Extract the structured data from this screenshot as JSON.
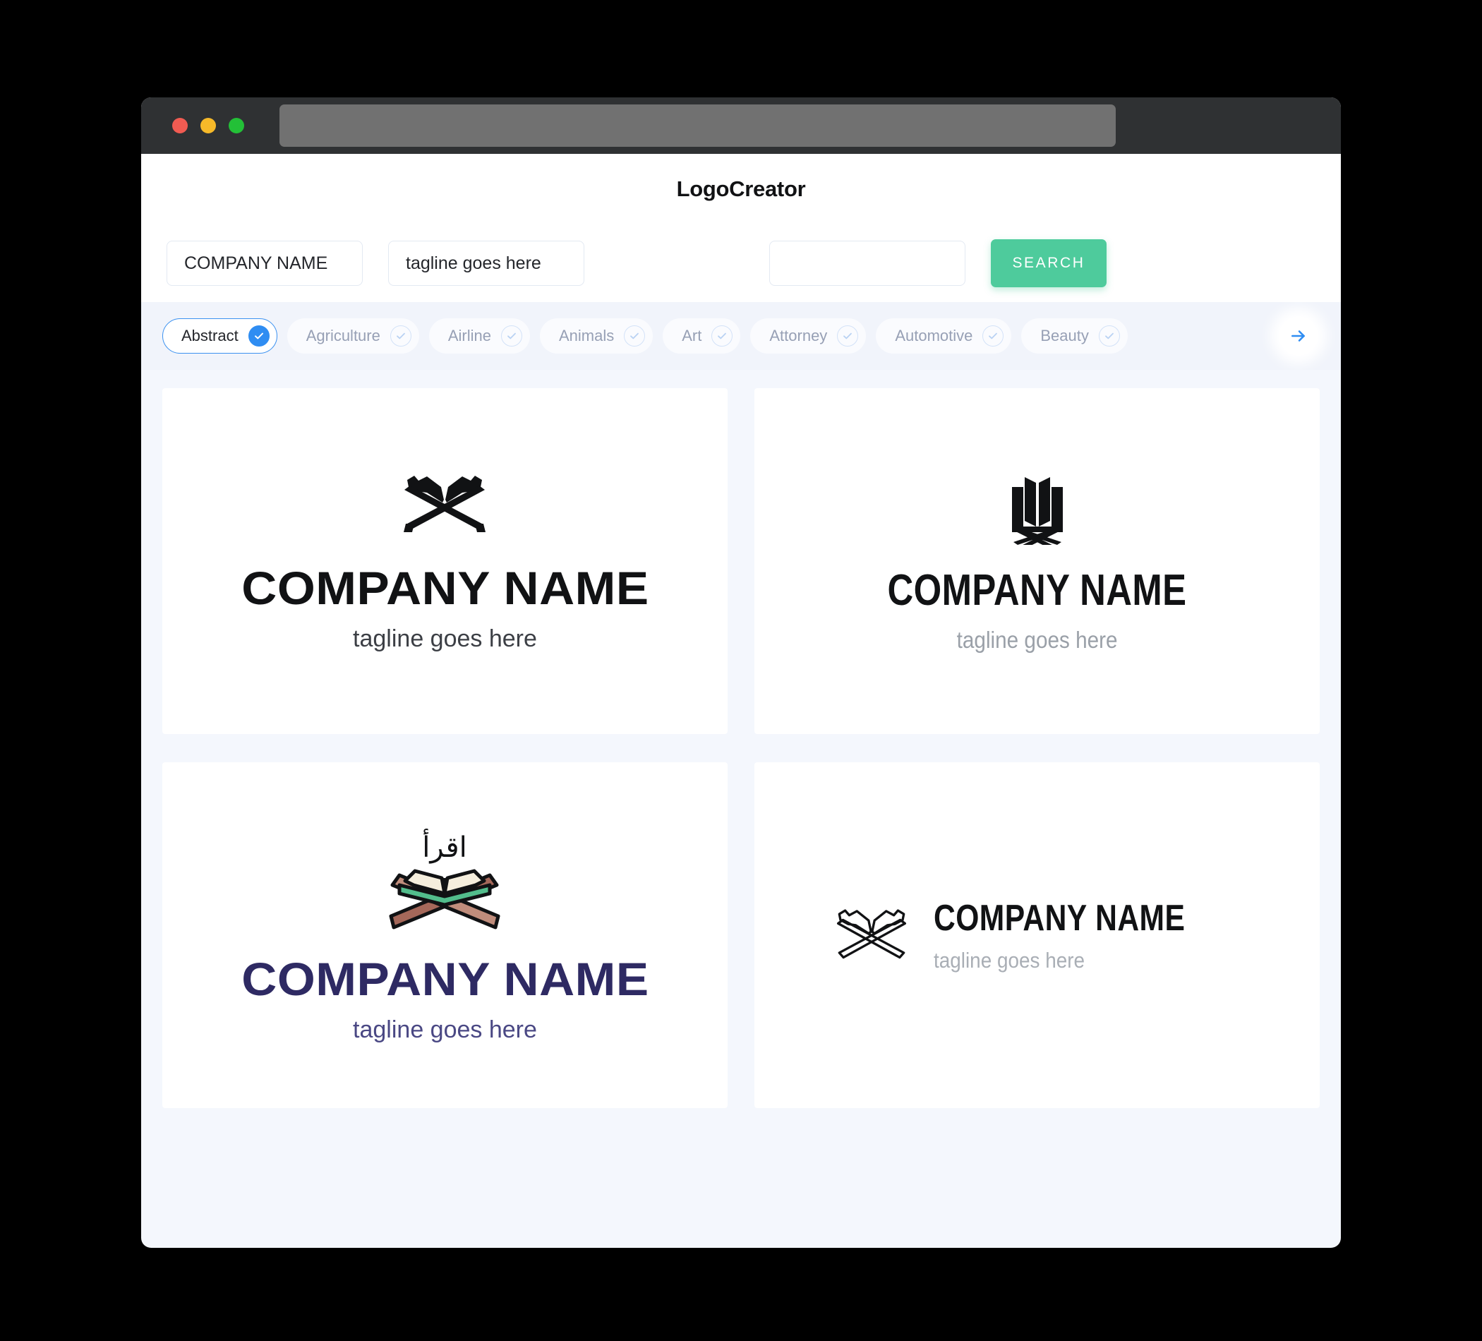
{
  "window": {
    "traffic_lights": [
      "close",
      "minimize",
      "maximize"
    ],
    "colors": {
      "close": "#f15b52",
      "minimize": "#f6b929",
      "maximize": "#23c037",
      "titlebar": "#2f3133",
      "urlbar": "#717171"
    },
    "url_value": ""
  },
  "header": {
    "app_title": "LogoCreator"
  },
  "search": {
    "company_value": "COMPANY NAME",
    "company_placeholder": "COMPANY NAME",
    "tagline_value": "tagline goes here",
    "tagline_placeholder": "tagline goes here",
    "extra_value": "",
    "extra_placeholder": "",
    "search_label": "SEARCH",
    "search_color": "#4ecb9c"
  },
  "chips": {
    "accent_color": "#2f8df2",
    "next_label": "→",
    "items": [
      {
        "label": "Abstract",
        "selected": true
      },
      {
        "label": "Agriculture",
        "selected": false
      },
      {
        "label": "Airline",
        "selected": false
      },
      {
        "label": "Animals",
        "selected": false
      },
      {
        "label": "Art",
        "selected": false
      },
      {
        "label": "Attorney",
        "selected": false
      },
      {
        "label": "Automotive",
        "selected": false
      },
      {
        "label": "Beauty",
        "selected": false
      }
    ]
  },
  "results": {
    "cards": [
      {
        "mark": "book-on-crossed-stand-solid-icon",
        "company_name": "COMPANY NAME",
        "tagline": "tagline goes here",
        "layout": "stacked",
        "name_color": "#111214",
        "tagline_color": "#3c3f45"
      },
      {
        "mark": "open-book-stand-icon",
        "company_name": "COMPANY NAME",
        "tagline": "tagline goes here",
        "layout": "stacked",
        "name_color": "#111214",
        "tagline_color": "#9aa0a8"
      },
      {
        "mark": "quran-rehal-color-icon",
        "arabic_text": "اقرأ",
        "company_name": "COMPANY NAME",
        "tagline": "tagline goes here",
        "layout": "stacked",
        "name_color": "#2e2a63",
        "tagline_color": "#4a4884"
      },
      {
        "mark": "book-on-crossed-stand-outline-icon",
        "company_name": "COMPANY NAME",
        "tagline": "tagline goes here",
        "layout": "horizontal",
        "name_color": "#111214",
        "tagline_color": "#a9aeb5"
      }
    ]
  }
}
